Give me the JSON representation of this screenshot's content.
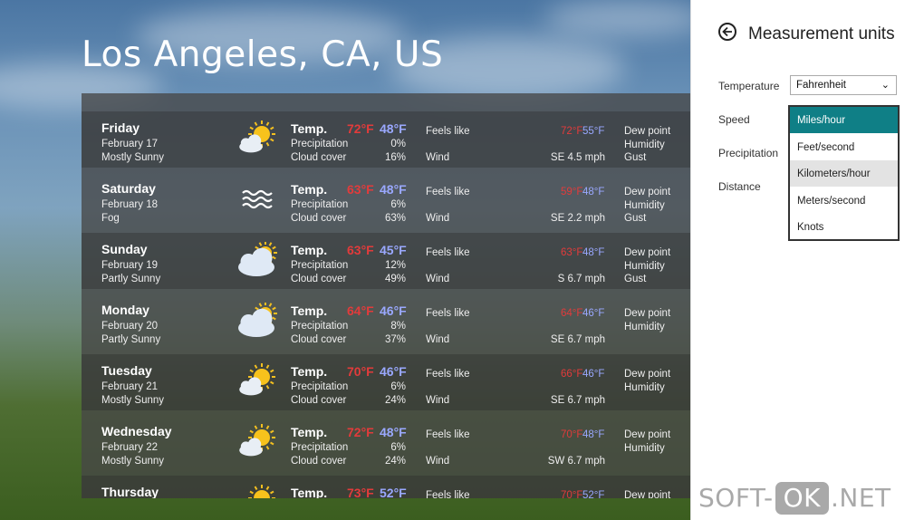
{
  "city": "Los Angeles, CA, US",
  "days": [
    {
      "day": "Friday",
      "date": "February 17",
      "condition": "Mostly Sunny",
      "icon": "sun-cloud-icon",
      "temp_label": "Temp.",
      "high": "72°F",
      "low": "48°F",
      "precip_label": "Precipitation",
      "precip": "0%",
      "cloud_label": "Cloud cover",
      "cloud": "16%",
      "feels_label": "Feels like",
      "feels_high": "72°F",
      "feels_low": "55°F",
      "wind_label": "Wind",
      "wind": "SE  4.5 mph",
      "dew_label": "Dew point",
      "humidity_label": "Humidity",
      "gust_label": "Gust"
    },
    {
      "day": "Saturday",
      "date": "February 18",
      "condition": "Fog",
      "icon": "fog-icon",
      "temp_label": "Temp.",
      "high": "63°F",
      "low": "48°F",
      "precip_label": "Precipitation",
      "precip": "6%",
      "cloud_label": "Cloud cover",
      "cloud": "63%",
      "feels_label": "Feels like",
      "feels_high": "59°F",
      "feels_low": "48°F",
      "wind_label": "Wind",
      "wind": "SE  2.2 mph",
      "dew_label": "Dew point",
      "humidity_label": "Humidity",
      "gust_label": "Gust"
    },
    {
      "day": "Sunday",
      "date": "February 19",
      "condition": "Partly Sunny",
      "icon": "partly-sunny-icon",
      "temp_label": "Temp.",
      "high": "63°F",
      "low": "45°F",
      "precip_label": "Precipitation",
      "precip": "12%",
      "cloud_label": "Cloud cover",
      "cloud": "49%",
      "feels_label": "Feels like",
      "feels_high": "63°F",
      "feels_low": "48°F",
      "wind_label": "Wind",
      "wind": "S  6.7 mph",
      "dew_label": "Dew point",
      "humidity_label": "Humidity",
      "gust_label": "Gust"
    },
    {
      "day": "Monday",
      "date": "February 20",
      "condition": "Partly Sunny",
      "icon": "partly-sunny-icon",
      "temp_label": "Temp.",
      "high": "64°F",
      "low": "46°F",
      "precip_label": "Precipitation",
      "precip": "8%",
      "cloud_label": "Cloud cover",
      "cloud": "37%",
      "feels_label": "Feels like",
      "feels_high": "64°F",
      "feels_low": "46°F",
      "wind_label": "Wind",
      "wind": "SE  6.7 mph",
      "dew_label": "Dew point",
      "humidity_label": "Humidity",
      "gust_label": ""
    },
    {
      "day": "Tuesday",
      "date": "February 21",
      "condition": "Mostly Sunny",
      "icon": "sun-cloud-icon",
      "temp_label": "Temp.",
      "high": "70°F",
      "low": "46°F",
      "precip_label": "Precipitation",
      "precip": "6%",
      "cloud_label": "Cloud cover",
      "cloud": "24%",
      "feels_label": "Feels like",
      "feels_high": "66°F",
      "feels_low": "46°F",
      "wind_label": "Wind",
      "wind": "SE  6.7 mph",
      "dew_label": "Dew point",
      "humidity_label": "Humidity",
      "gust_label": ""
    },
    {
      "day": "Wednesday",
      "date": "February 22",
      "condition": "Mostly Sunny",
      "icon": "sun-cloud-icon",
      "temp_label": "Temp.",
      "high": "72°F",
      "low": "48°F",
      "precip_label": "Precipitation",
      "precip": "6%",
      "cloud_label": "Cloud cover",
      "cloud": "24%",
      "feels_label": "Feels like",
      "feels_high": "70°F",
      "feels_low": "48°F",
      "wind_label": "Wind",
      "wind": "SW  6.7 mph",
      "dew_label": "Dew point",
      "humidity_label": "Humidity",
      "gust_label": ""
    },
    {
      "day": "Thursday",
      "date": "",
      "condition": "",
      "icon": "sun-cloud-icon",
      "temp_label": "Temp.",
      "high": "73°F",
      "low": "52°F",
      "precip_label": "",
      "precip": "",
      "cloud_label": "",
      "cloud": "",
      "feels_label": "Feels like",
      "feels_high": "70°F",
      "feels_low": "52°F",
      "wind_label": "",
      "wind": "",
      "dew_label": "Dew point",
      "humidity_label": "",
      "gust_label": ""
    }
  ],
  "panel": {
    "title": "Measurement units",
    "temperature_label": "Temperature",
    "temperature_value": "Fahrenheit",
    "speed_label": "Speed",
    "precipitation_label": "Precipitation",
    "distance_label": "Distance",
    "speed_options": [
      "Miles/hour",
      "Feet/second",
      "Kilometers/hour",
      "Meters/second",
      "Knots"
    ],
    "speed_selected": "Miles/hour",
    "speed_hovered": "Kilometers/hour"
  },
  "watermark": {
    "pre": "SOFT-",
    "ok": "OK",
    "post": ".NET"
  },
  "colors": {
    "high": "#e23b3b",
    "low": "#9aa8ff",
    "accent": "#0f7f86"
  }
}
